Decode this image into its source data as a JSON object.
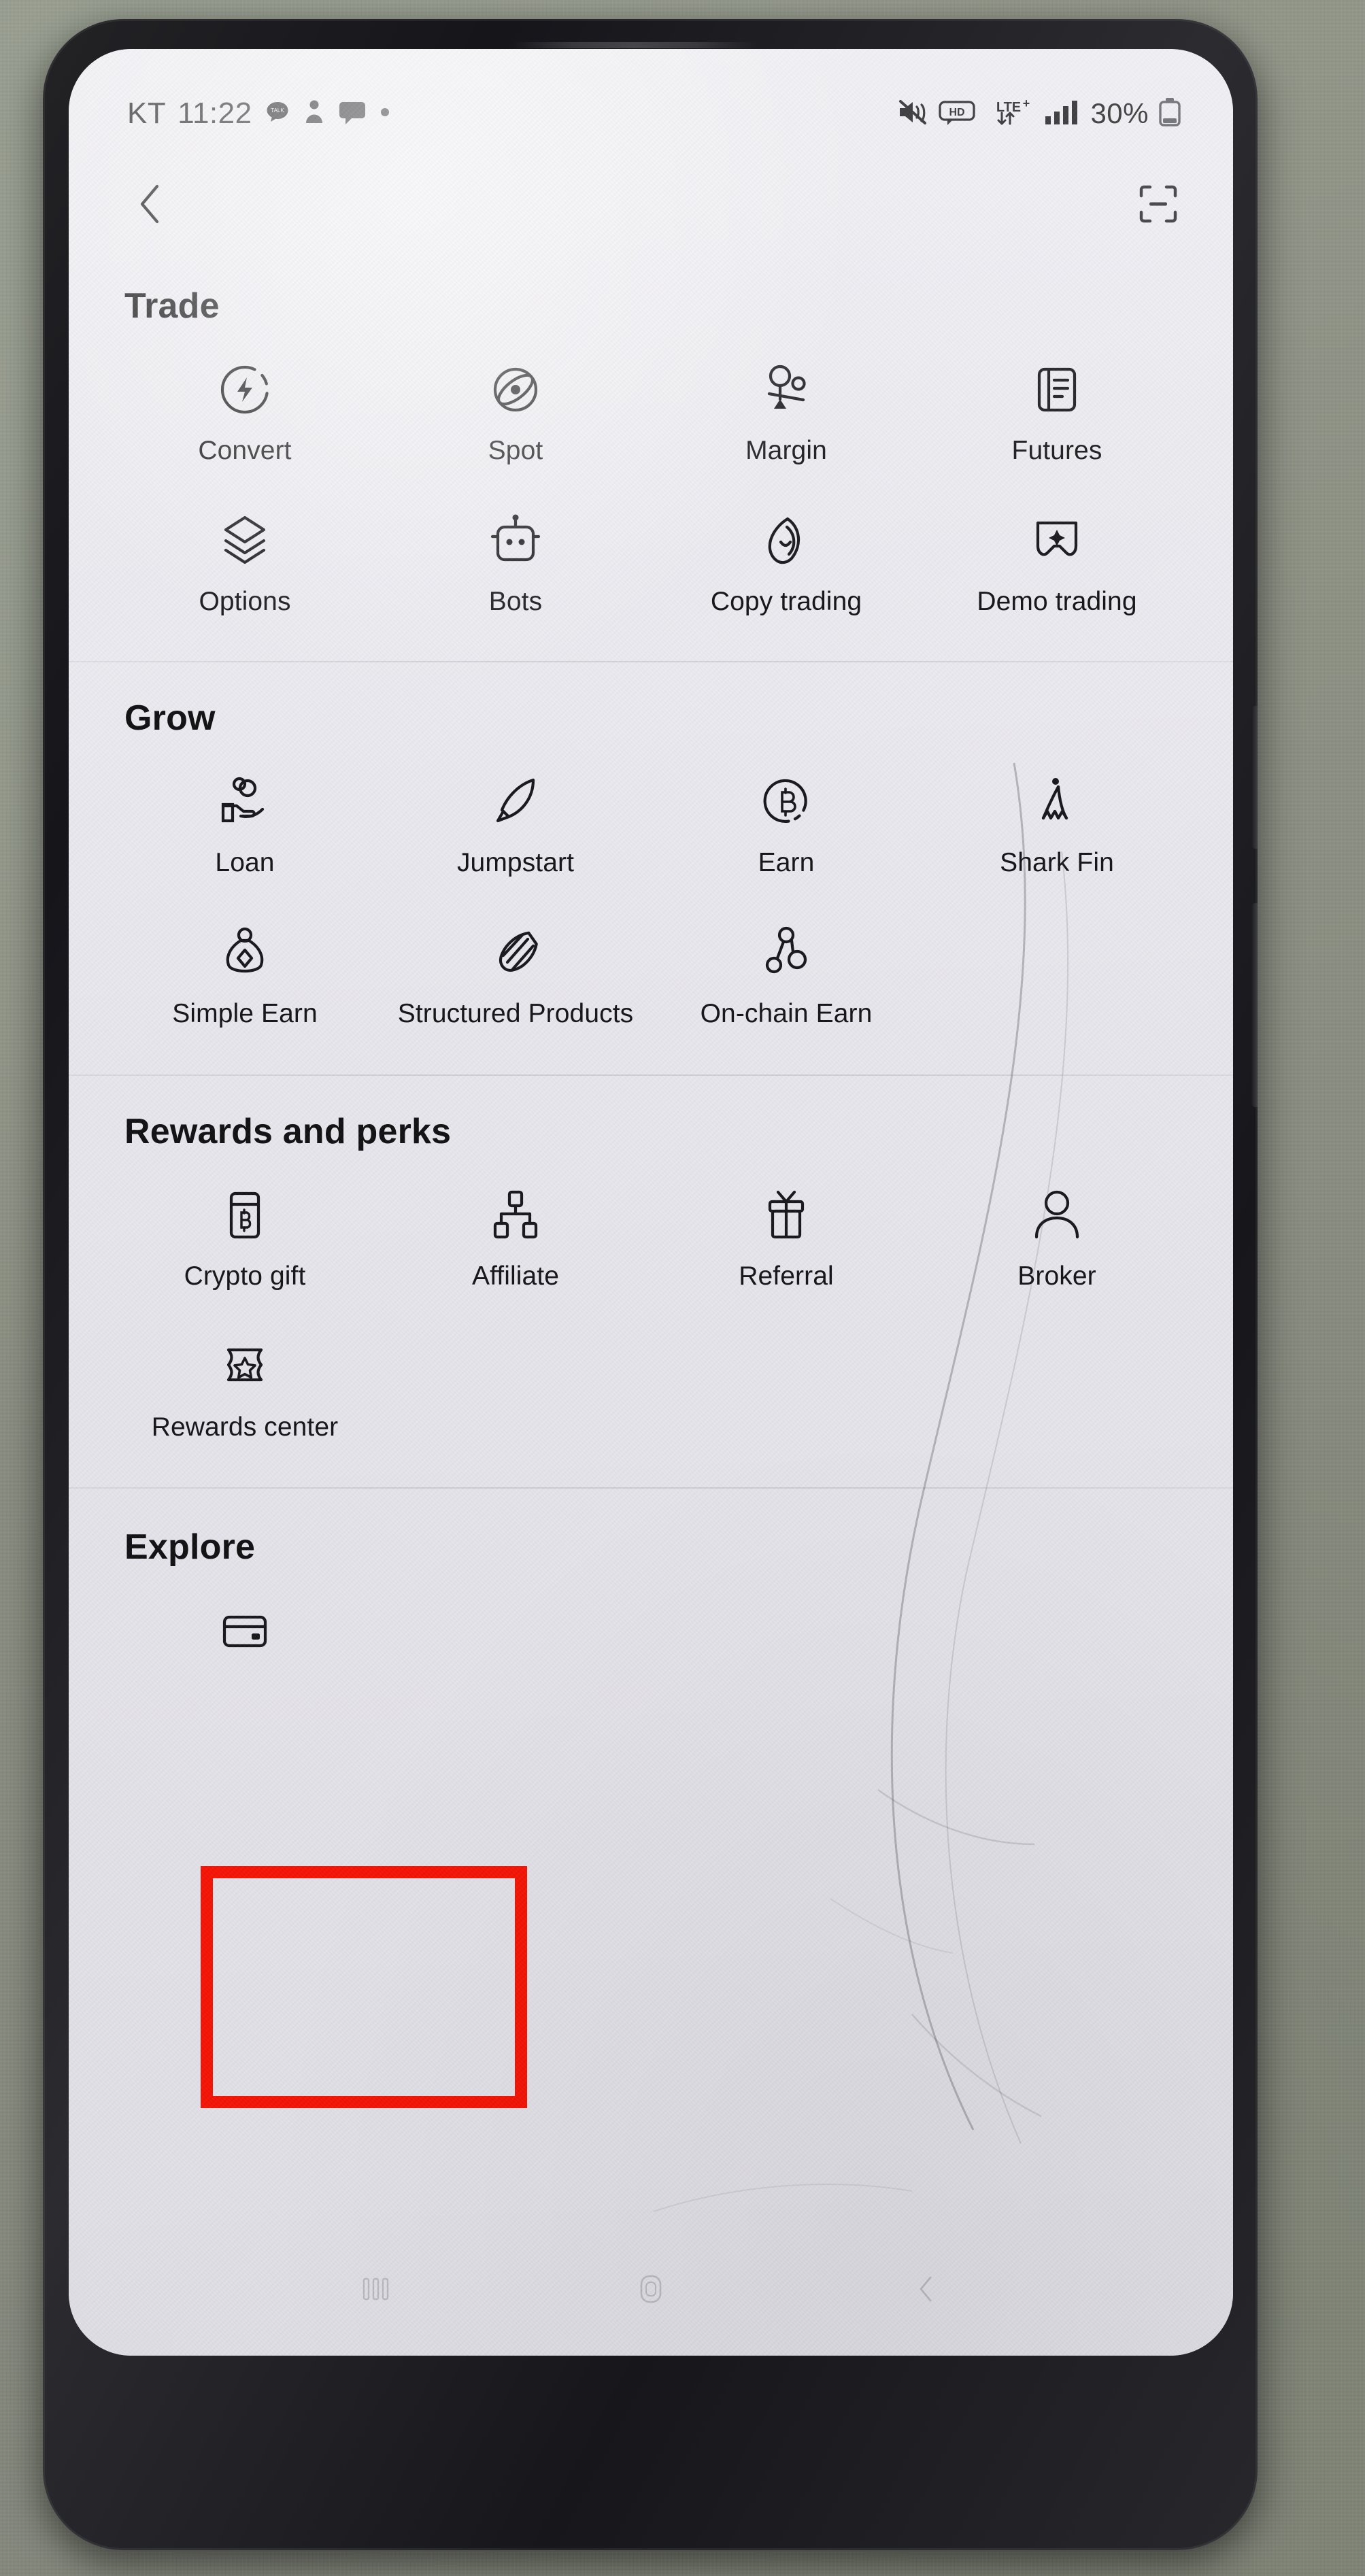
{
  "device": {
    "frame_color": "#1d1d21",
    "backdrop_color": "#8e9286",
    "screen_bg": "#ecebf0"
  },
  "status_bar": {
    "carrier": "KT",
    "time": "11:22",
    "left_icons": [
      "kakaotalk-icon",
      "person-notification-icon",
      "message-bubble-icon",
      "dot-indicator-icon"
    ],
    "right_icons": [
      "mute-icon",
      "hd-voice-icon",
      "lte-plus-icon",
      "signal-bars-icon"
    ],
    "battery_percent": "30%",
    "battery_icon": "battery-icon"
  },
  "nav": {
    "back_label": "Back",
    "back_icon": "chevron-left-icon",
    "scan_label": "Scan",
    "scan_icon": "qr-scan-icon"
  },
  "highlight": {
    "target": "Rewards center",
    "color": "#fa1405",
    "border_width_px": 18
  },
  "sections": [
    {
      "title": "Trade",
      "rows": [
        [
          {
            "label": "Convert",
            "icon": "convert-icon"
          },
          {
            "label": "Spot",
            "icon": "spot-icon"
          },
          {
            "label": "Margin",
            "icon": "margin-icon"
          },
          {
            "label": "Futures",
            "icon": "futures-icon"
          }
        ],
        [
          {
            "label": "Options",
            "icon": "options-icon"
          },
          {
            "label": "Bots",
            "icon": "bots-icon"
          },
          {
            "label": "Copy trading",
            "icon": "copy-trading-icon"
          },
          {
            "label": "Demo trading",
            "icon": "demo-trading-icon"
          }
        ]
      ]
    },
    {
      "title": "Grow",
      "rows": [
        [
          {
            "label": "Loan",
            "icon": "loan-icon"
          },
          {
            "label": "Jumpstart",
            "icon": "jumpstart-icon"
          },
          {
            "label": "Earn",
            "icon": "earn-icon"
          },
          {
            "label": "Shark Fin",
            "icon": "shark-fin-icon"
          }
        ],
        [
          {
            "label": "Simple Earn",
            "icon": "simple-earn-icon"
          },
          {
            "label": "Structured Products",
            "icon": "structured-products-icon"
          },
          {
            "label": "On-chain Earn",
            "icon": "on-chain-earn-icon"
          }
        ]
      ]
    },
    {
      "title": "Rewards and perks",
      "rows": [
        [
          {
            "label": "Crypto gift",
            "icon": "crypto-gift-icon"
          },
          {
            "label": "Affiliate",
            "icon": "affiliate-icon"
          },
          {
            "label": "Referral",
            "icon": "referral-icon"
          },
          {
            "label": "Broker",
            "icon": "broker-icon"
          }
        ],
        [
          {
            "label": "Rewards center",
            "icon": "rewards-center-icon",
            "highlighted": true
          }
        ]
      ]
    },
    {
      "title": "Explore",
      "rows": [
        [
          {
            "label": "",
            "icon": "card-icon"
          }
        ]
      ]
    }
  ]
}
